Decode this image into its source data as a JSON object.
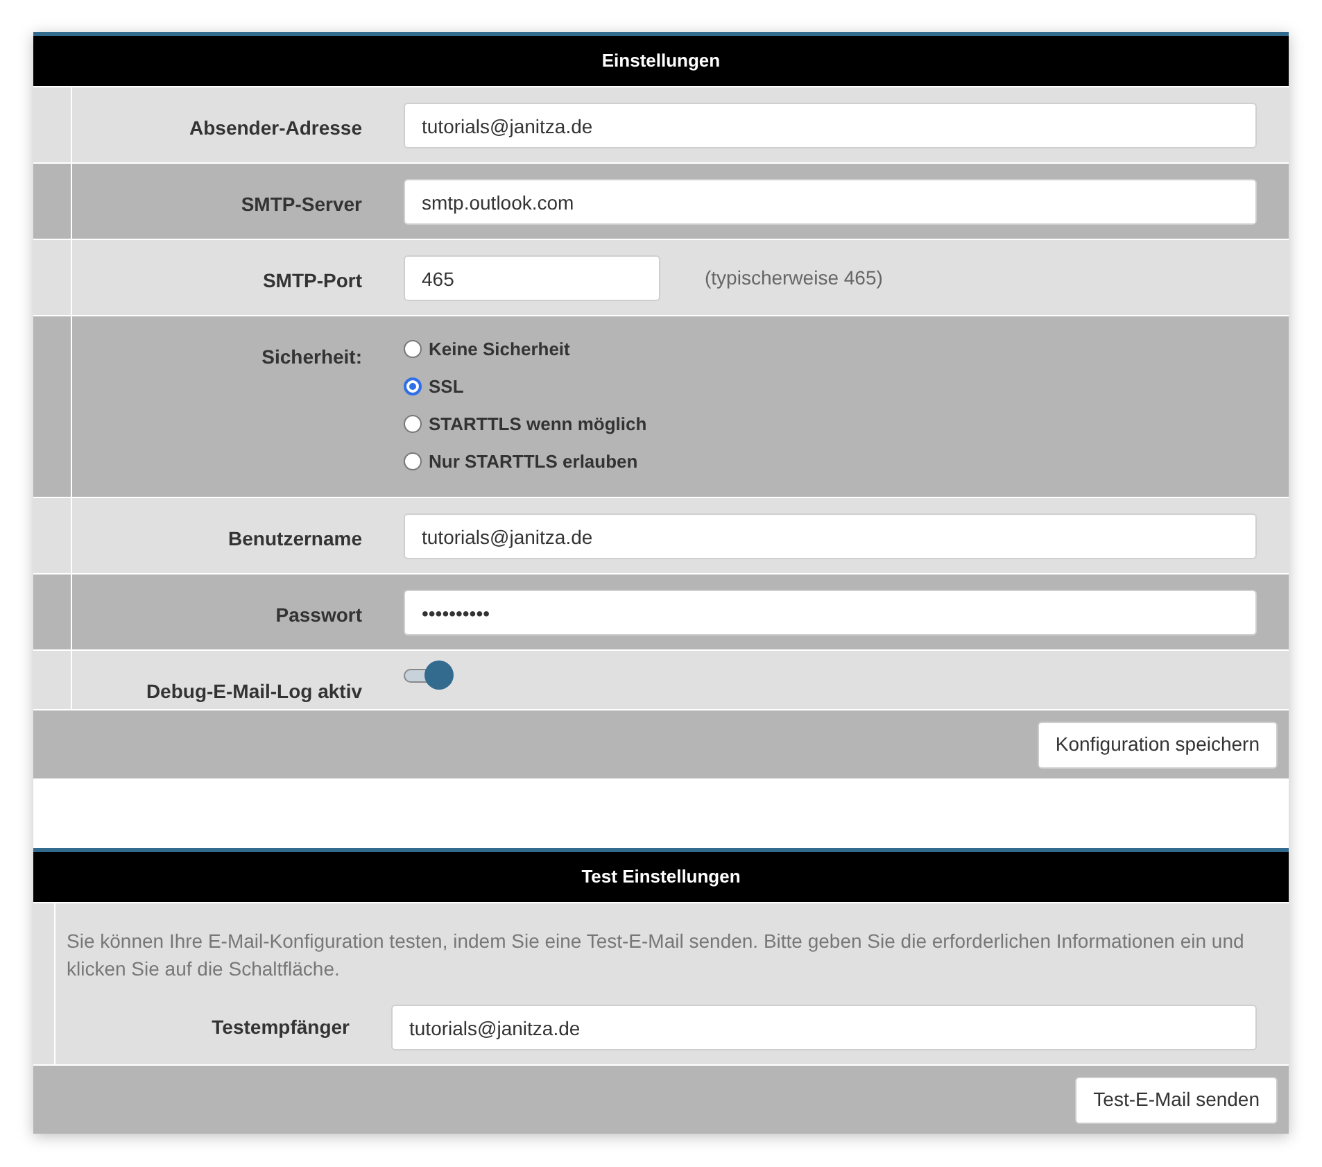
{
  "settings": {
    "title": "Einstellungen",
    "rows": [
      {
        "kind": "input",
        "label": "Absender-Adresse",
        "value": "tutorials@janitza.de"
      },
      {
        "kind": "input",
        "label": "SMTP-Server",
        "value": "smtp.outlook.com"
      },
      {
        "kind": "input",
        "label": "SMTP-Port",
        "value": "465",
        "hint": "(typischerweise 465)"
      },
      {
        "kind": "radio",
        "label": "Sicherheit:",
        "options": [
          {
            "label": "Keine Sicherheit",
            "selected": false
          },
          {
            "label": "SSL",
            "selected": true
          },
          {
            "label": "STARTTLS wenn möglich",
            "selected": false
          },
          {
            "label": "Nur STARTTLS erlauben",
            "selected": false
          }
        ]
      },
      {
        "kind": "input",
        "label": "Benutzername",
        "value": "tutorials@janitza.de"
      },
      {
        "kind": "input",
        "label": "Passwort",
        "value": "••••••••••"
      },
      {
        "kind": "toggle",
        "label": "Debug-E-Mail-Log aktiv",
        "on": true
      }
    ],
    "button": "Konfiguration speichern"
  },
  "test": {
    "title": "Test Einstellungen",
    "description": "Sie können Ihre E-Mail-Konfiguration testen, indem Sie eine Test-E-Mail senden. Bitte geben Sie die erforderlichen Informationen ein und klicken Sie auf die Schaltfläche.",
    "recipient_label": "Testempfänger",
    "recipient_value": "tutorials@janitza.de",
    "button": "Test-E-Mail senden"
  }
}
